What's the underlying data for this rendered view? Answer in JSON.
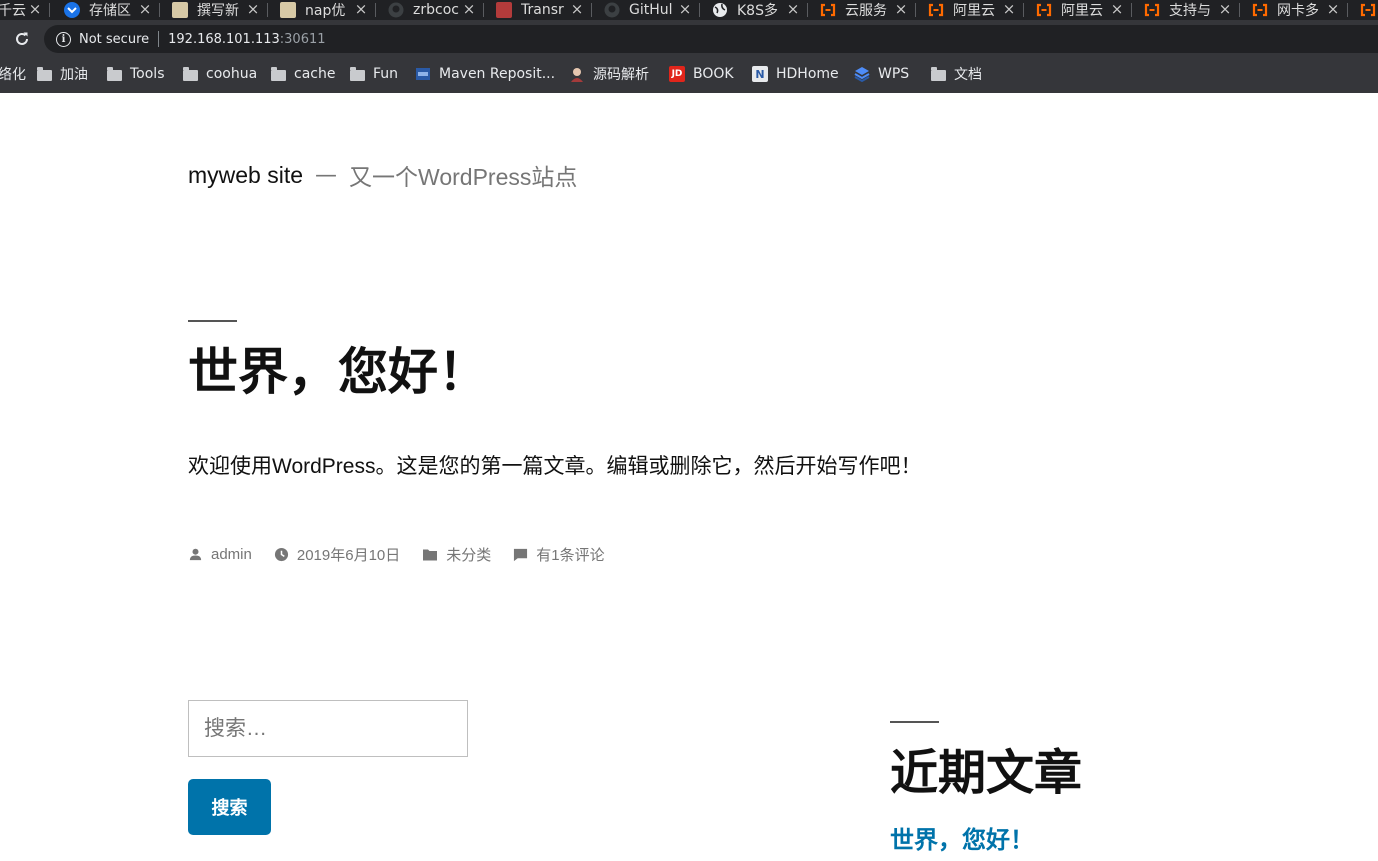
{
  "browser": {
    "tabs": [
      {
        "title": "千云",
        "favicon": "generic-icon",
        "icon_color": "#9aa0a6"
      },
      {
        "title": "存储区",
        "favicon": "shield-badge-icon",
        "icon_color": "#1a73e8"
      },
      {
        "title": "撰写新",
        "favicon": "avatar-icon",
        "icon_color": "#d7c9a6"
      },
      {
        "title": "nap优",
        "favicon": "avatar-icon",
        "icon_color": "#d7c9a6"
      },
      {
        "title": "zrbcoc",
        "favicon": "github-icon",
        "icon_color": "#3c4043"
      },
      {
        "title": "Transr",
        "favicon": "character-icon",
        "icon_color": "#b33b3b"
      },
      {
        "title": "GitHul",
        "favicon": "github-icon",
        "icon_color": "#3c4043"
      },
      {
        "title": "K8S多",
        "favicon": "globe-icon",
        "icon_color": "#e8eaed"
      },
      {
        "title": "云服务",
        "favicon": "aliyun-icon",
        "icon_color": "#ff6a00"
      },
      {
        "title": "阿里云",
        "favicon": "aliyun-icon",
        "icon_color": "#ff6a00"
      },
      {
        "title": "阿里云",
        "favicon": "aliyun-icon",
        "icon_color": "#ff6a00"
      },
      {
        "title": "支持与",
        "favicon": "aliyun-icon",
        "icon_color": "#ff6a00"
      },
      {
        "title": "网卡多",
        "favicon": "aliyun-icon",
        "icon_color": "#ff6a00"
      },
      {
        "title": "",
        "favicon": "aliyun-icon",
        "icon_color": "#ff6a00"
      }
    ],
    "close_glyph": "×",
    "security_label": "Not secure",
    "url_host": "192.168.101.113",
    "url_port": ":30611",
    "bookmarks": [
      {
        "label": "络化",
        "icon": "none"
      },
      {
        "label": "加油",
        "icon": "folder-icon"
      },
      {
        "label": "Tools",
        "icon": "folder-icon"
      },
      {
        "label": "coohua",
        "icon": "folder-icon"
      },
      {
        "label": "cache",
        "icon": "folder-icon"
      },
      {
        "label": "Fun",
        "icon": "folder-icon"
      },
      {
        "label": "Maven Reposit...",
        "icon": "maven-icon"
      },
      {
        "label": "源码解析",
        "icon": "avatar-icon"
      },
      {
        "label": "BOOK",
        "icon": "jd-icon",
        "icon_text": "JD"
      },
      {
        "label": "HDHome",
        "icon": "notion-icon",
        "icon_text": "N"
      },
      {
        "label": "WPS",
        "icon": "layers-icon"
      },
      {
        "label": "文档",
        "icon": "folder-icon"
      }
    ]
  },
  "site": {
    "title": "myweb site",
    "separator": "—",
    "description": "又一个WordPress站点"
  },
  "post": {
    "title": "世界，您好！",
    "body": "欢迎使用WordPress。这是您的第一篇文章。编辑或删除它，然后开始写作吧！",
    "meta": {
      "author": "admin",
      "date": "2019年6月10日",
      "category": "未分类",
      "comments": "有1条评论"
    }
  },
  "search": {
    "placeholder": "搜索…",
    "button_label": "搜索"
  },
  "recent_posts": {
    "heading": "近期文章",
    "items": [
      "世界，您好！"
    ]
  },
  "colors": {
    "link": "#0073aa",
    "button": "#0073aa",
    "text": "#111111",
    "muted": "#767676"
  }
}
